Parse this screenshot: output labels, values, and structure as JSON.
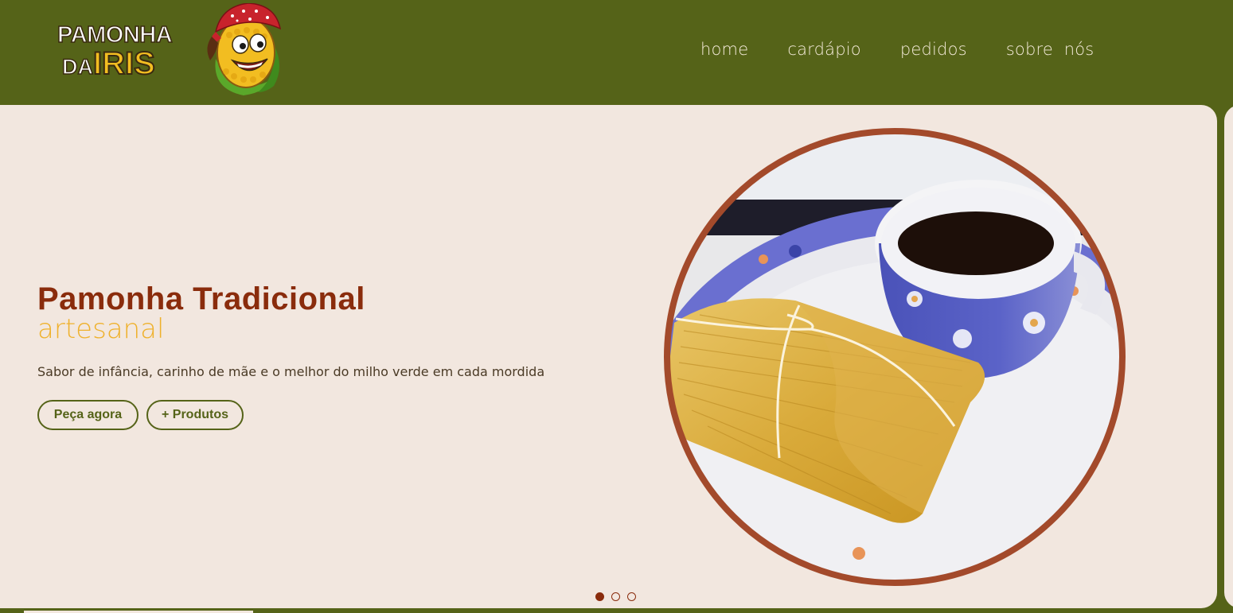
{
  "brand": {
    "logo_line1": "PAMONHA",
    "logo_line2_a": "DA",
    "logo_line2_b": "IRIS",
    "logo_icon": "corn-mascot-icon"
  },
  "nav": {
    "items": [
      {
        "label": "home"
      },
      {
        "label": "cardápio"
      },
      {
        "label": "pedidos"
      },
      {
        "label": "sobre  nós"
      }
    ]
  },
  "hero": {
    "title": "Pamonha Tradicional",
    "subtitle": "artesanal",
    "description": "Sabor de infância, carinho de mãe e o melhor do milho verde em cada mordida",
    "buttons": {
      "order_label": "Peça agora",
      "products_label": "+ Produtos"
    },
    "image_icon": "pamonha-coffee-photo"
  },
  "carousel": {
    "slides_count": 3,
    "active_index": 0
  },
  "colors": {
    "header_bg": "#556318",
    "slide_bg": "#f2e7df",
    "title": "#8a2c0c",
    "subtitle": "#efb12c",
    "button": "#556318",
    "photo_border": "#a34a2b"
  }
}
